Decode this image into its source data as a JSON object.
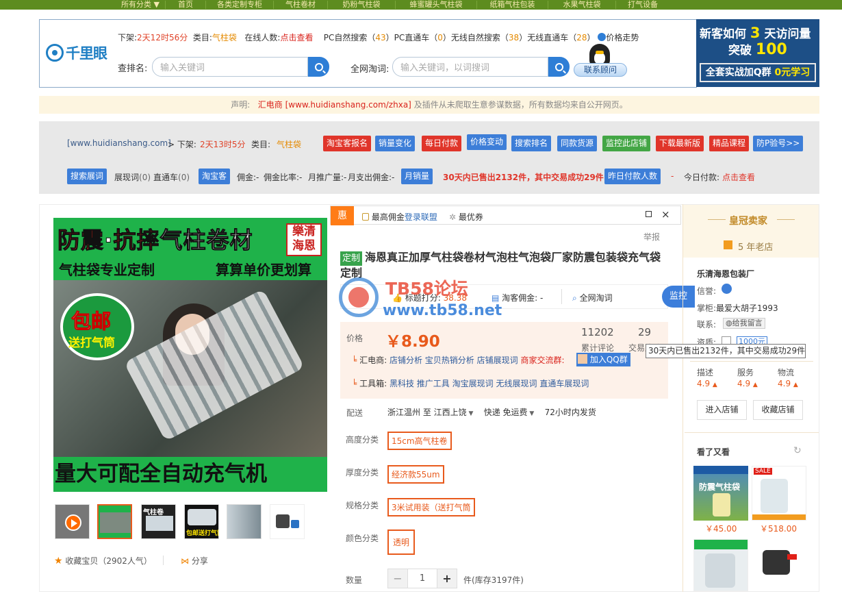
{
  "topnav": {
    "items": [
      "所有分类 ▼",
      "首页",
      "各类定制专柜",
      "气柱卷材",
      "奶粉气柱袋",
      "蜂蜜罐头气柱袋",
      "纸箱气柱包装",
      "水果气柱袋",
      "打气设备"
    ]
  },
  "header": {
    "logo_text": "千里眼",
    "shelf_label": "下架:",
    "shelf_value": "2天12时56分",
    "category_label": "类目:",
    "category_value": "气柱袋",
    "online_label": "在线人数:",
    "online_link": "点击查看",
    "pc_natural": "PC自然搜索（",
    "pc_natural_val": "43",
    "pc_direct": "）PC直通车（",
    "pc_direct_val": "0",
    "wireless_natural": "）无线自然搜索（",
    "wireless_natural_val": "38",
    "wireless_direct": "）无线直通车（",
    "wireless_direct_val": "28",
    "close_paren": "）",
    "price_trend": "价格走势",
    "rank_label": "查排名:",
    "rank_placeholder": "输入关键词",
    "global_label": "全网淘词:",
    "global_placeholder": "输入关键词，以词搜词",
    "contact_btn": "联系顾问"
  },
  "ad": {
    "line1a": "新客如何",
    "line1b": "3",
    "line1c": "天访问量",
    "line2a": "突破",
    "line2b": "100",
    "line3a": "全套实战加Q群",
    "line3b": "0元学习"
  },
  "notice": {
    "prefix": "声明:",
    "site": "汇电商 [www.huidianshang.com/zhxa]",
    "suffix": "及插件从未爬取生意参谋数据，所有数据均来自公开网页。"
  },
  "panel": {
    "site": "[www.huidianshang.com]",
    "shelf": "> 下架:",
    "shelf_value": "2天13时5分",
    "category": "类目:",
    "category_value": "气柱袋",
    "tags_row1": [
      "淘宝客报名",
      "销量变化",
      "每日付款",
      "价格变动",
      "搜索排名",
      "同款货源",
      "监控此店铺",
      "下载最新版",
      "精品课程",
      "防P验号>>"
    ],
    "tag_search_words": "搜索展词",
    "show_words": "展现词",
    "show_words_val": "(0)",
    "direct": "直通车",
    "direct_val": "(0)",
    "tag_taoke": "淘宝客",
    "commission": "佣金:-",
    "commission_rate": "佣金比率:-",
    "monthly_promo": "月推广量:-",
    "monthly_pay": "月支出佣金:-",
    "tag_monthly_sales": "月销量",
    "monthly_sales_text": "30天内已售出2132件，其中交易成功29件",
    "tag_yesterday": "昨日付款人数",
    "yesterday_val": "-",
    "today_label": "今日付款:",
    "today_link": "点击查看"
  },
  "main_image": {
    "line1a": "防震",
    "line1b": "·",
    "line1c": "抗摔",
    "line1d": "气柱卷材",
    "stamp": "樂清海恩",
    "line2": "气柱袋专业定制",
    "line3": "算算单价更划算",
    "badge1": "包邮",
    "badge2": "送打气筒",
    "bottom": "量大可配全自动充气机"
  },
  "thumbs": [
    "气柱卷",
    "包邮送打气筒"
  ],
  "favorite": "收藏宝贝（2902人气）",
  "share": "分享",
  "popbar": {
    "badge": "惠",
    "max_commission": "最高佣金",
    "login": "登录联盟",
    "best_coupon": "最优券"
  },
  "report": "举报",
  "product": {
    "custom_tag": "定制",
    "title": "海恩真正加厚气柱袋卷材气泡柱气泡袋厂家防震包装袋充气袋定制",
    "title_score_label": "标题打分:",
    "title_score": "38.38",
    "taoke_label": "淘客佣金:",
    "taoke_val": "-",
    "global_word": "全网淘词",
    "monitor": "监控",
    "price_label": "价格",
    "price": "￥8.90",
    "reviews_val": "11202",
    "reviews_label": "累计评论",
    "trades_val": "29",
    "trades_label": "交易成功",
    "hds_label": "汇电商:",
    "hds_links": [
      "店铺分析",
      "宝贝热销分析",
      "店铺展现词"
    ],
    "merchant_group": "商家交流群:",
    "join_qq": "加入QQ群",
    "tools_label": "工具箱:",
    "tools_links": [
      "黑科技",
      "推广工具",
      "淘宝展现词",
      "无线展现词",
      "直通车展现词"
    ],
    "ship_label": "配送",
    "ship_from": "浙江温州 至",
    "ship_to": "江西上饶",
    "ship_method": "快递 免运费",
    "ship_time": "72小时内发货",
    "height_label": "高度分类",
    "height_opt": "15cm高气柱卷",
    "thick_label": "厚度分类",
    "thick_opt": "经济款55um",
    "spec_label": "规格分类",
    "spec_opt": "3米试用装（送打气筒",
    "color_label": "颜色分类",
    "color_opt": "透明",
    "qty_label": "数量",
    "qty_val": "1",
    "stock": "件(库存3197件)"
  },
  "watermark": {
    "line1": "TB58论坛",
    "line2": "www.tb58.net"
  },
  "tooltip": "30天内已售出2132件，其中交易成功29件",
  "seller": {
    "crown": "皇冠卖家",
    "years": "5 年老店",
    "shop": "乐清海恩包装厂",
    "credit_label": "信誉:",
    "keeper_label": "掌柜:",
    "keeper": "最爱大胡子1993",
    "contact_label": "联系:",
    "contact_btn": "给我留言",
    "qual_label": "资质:",
    "qual_val": "1000元",
    "desc": "描述",
    "desc_val": "4.9",
    "service": "服务",
    "service_val": "4.9",
    "logistics": "物流",
    "logistics_val": "4.9",
    "enter_shop": "进入店铺",
    "fav_shop": "收藏店铺"
  },
  "also_viewed": {
    "title": "看了又看",
    "price1": "￥45.00",
    "price2": "￥518.00",
    "img1_text": "防震气柱袋",
    "img2_text": "SALE"
  },
  "colors": {
    "accent_green": "#5d8c1f",
    "brand_blue": "#1f7fc4",
    "price_orange": "#e85a1c",
    "tag_red": "#e0352a",
    "tag_blue": "#3d7ed8"
  }
}
